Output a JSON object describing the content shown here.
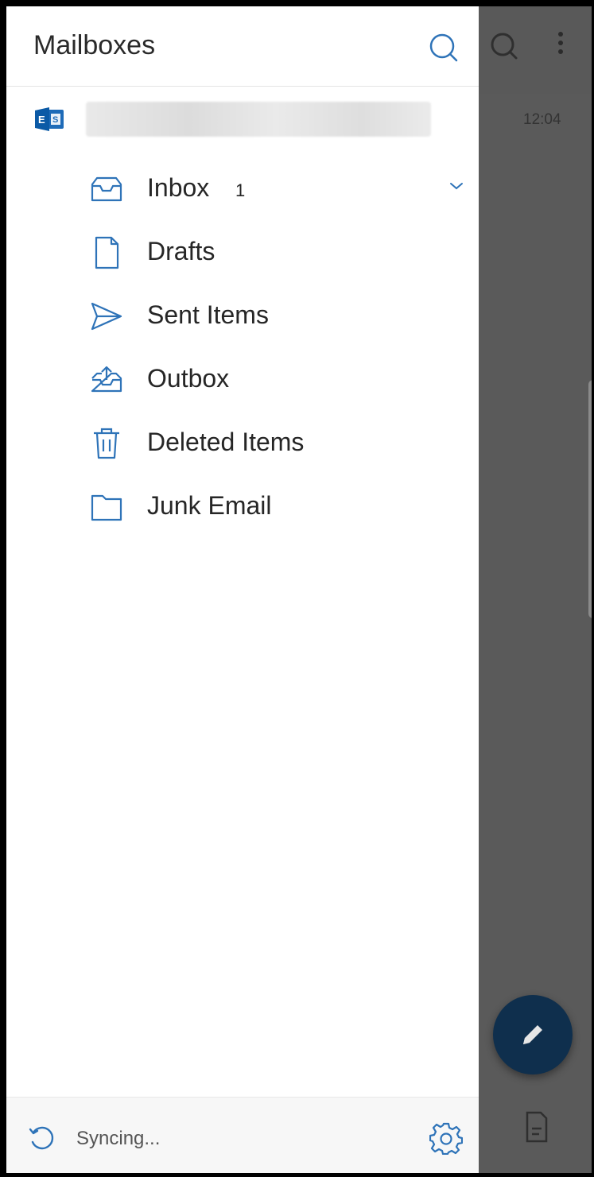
{
  "drawer": {
    "title": "Mailboxes",
    "account": {
      "type_icon": "exchange-icon",
      "name_redacted": true
    },
    "folders": [
      {
        "label": "Inbox",
        "count": "1",
        "icon": "inbox-icon",
        "expandable": true
      },
      {
        "label": "Drafts",
        "icon": "draft-document-icon"
      },
      {
        "label": "Sent Items",
        "icon": "send-icon"
      },
      {
        "label": "Outbox",
        "icon": "outbox-tray-icon"
      },
      {
        "label": "Deleted Items",
        "icon": "trash-icon"
      },
      {
        "label": "Junk Email",
        "icon": "folder-icon"
      }
    ],
    "footer": {
      "status": "Syncing...",
      "sync_icon": "sync-icon",
      "settings_icon": "gear-icon"
    }
  },
  "background": {
    "message_time": "12:04"
  },
  "colors": {
    "accent": "#2e73b8",
    "drawer_bg": "#ffffff",
    "overlay": "#595959",
    "fab": "#0f2f4d"
  }
}
